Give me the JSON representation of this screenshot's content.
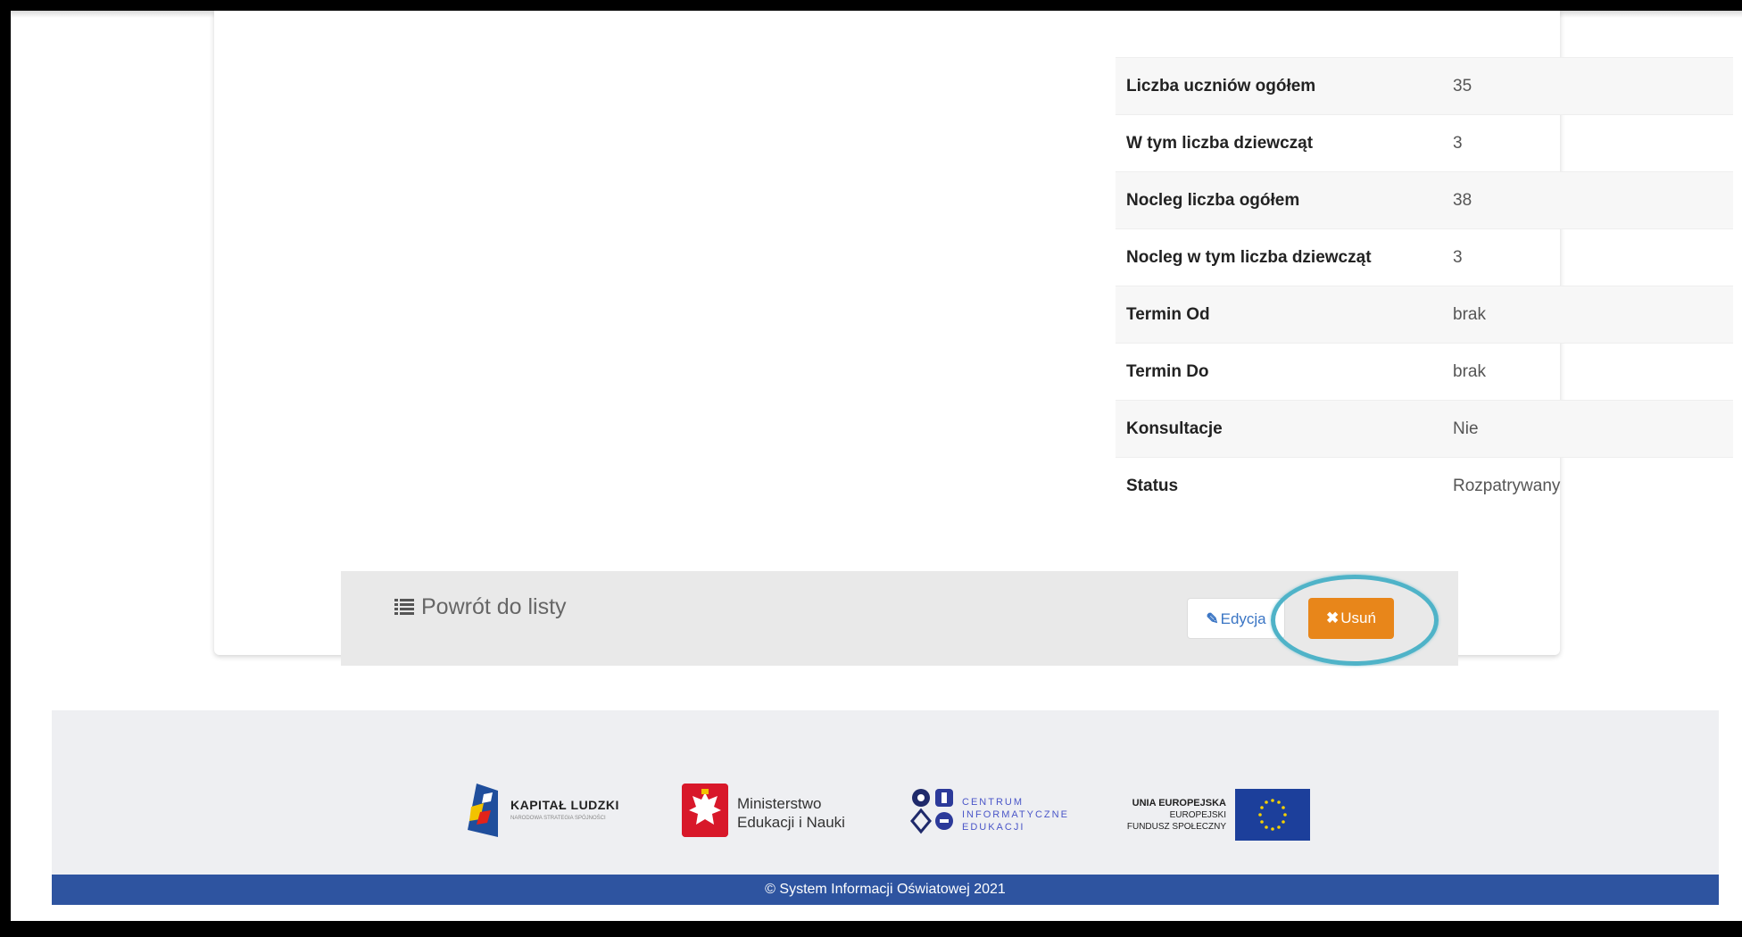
{
  "details": [
    {
      "label": "Liczba uczniów ogółem",
      "value": "35"
    },
    {
      "label": "W tym liczba dziewcząt",
      "value": "3"
    },
    {
      "label": "Nocleg liczba ogółem",
      "value": "38"
    },
    {
      "label": "Nocleg w tym liczba dziewcząt",
      "value": "3"
    },
    {
      "label": "Termin Od",
      "value": "brak"
    },
    {
      "label": "Termin Do",
      "value": "brak"
    },
    {
      "label": "Konsultacje",
      "value": "Nie"
    },
    {
      "label": "Status",
      "value": "Rozpatrywany"
    }
  ],
  "actions": {
    "back_label": "Powrót do listy",
    "edit_label": "Edycja",
    "delete_label": "Usuń",
    "delete_color": "#e8861a",
    "highlight_color": "#4fb3c8"
  },
  "footer": {
    "logos": {
      "kapital_ludzki": {
        "name": "KAPITAŁ LUDZKI",
        "tagline": "NARODOWA STRATEGIA SPÓJNOŚCI"
      },
      "men": {
        "line1": "Ministerstwo",
        "line2": "Edukacji i Nauki"
      },
      "cie": {
        "line1": "CENTRUM",
        "line2": "INFORMATYCZNE",
        "line3": "EDUKACJI"
      },
      "ue": {
        "line1": "UNIA EUROPEJSKA",
        "line2": "EUROPEJSKI",
        "line3": "FUNDUSZ SPOŁECZNY"
      }
    },
    "copyright": "© System Informacji Oświatowej 2021",
    "bar_color": "#2e54a0"
  }
}
